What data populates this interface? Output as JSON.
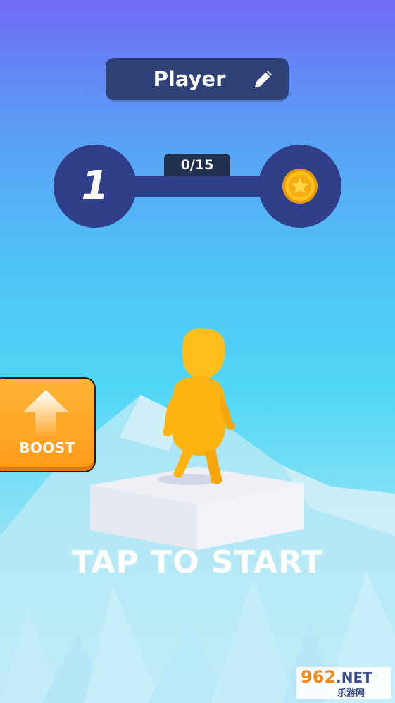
{
  "player": {
    "name": "Player"
  },
  "level": {
    "current": "1",
    "progress": "0/15"
  },
  "boost": {
    "label": "BOOST"
  },
  "prompt": {
    "tap_to_start": "TAP TO START"
  },
  "watermark": {
    "main": "962",
    "suffix": ".NET",
    "sub": "乐游网"
  },
  "icons": {
    "edit": "pencil-icon",
    "reward": "star-coin-icon",
    "boost": "up-arrow-icon"
  },
  "colors": {
    "panel": "#2f3f8a",
    "boost": "#ff9a1a",
    "character": "#ffbe1a"
  }
}
